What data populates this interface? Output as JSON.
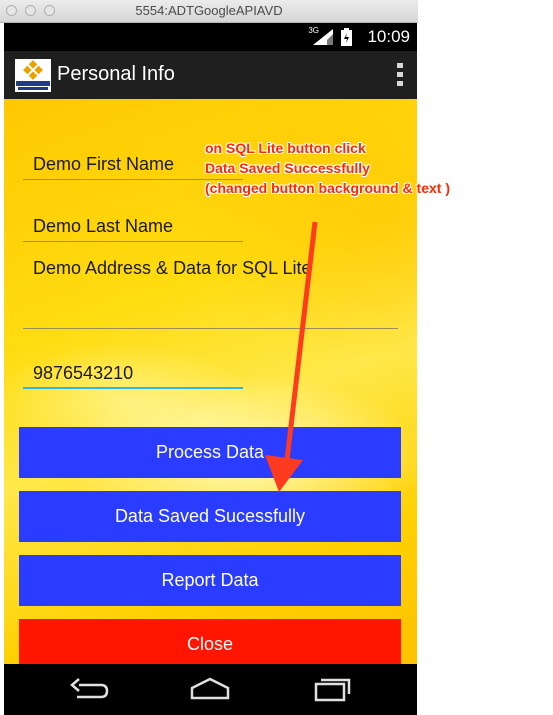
{
  "window": {
    "title": "5554:ADTGoogleAPIAVD"
  },
  "status_bar": {
    "network": "3G",
    "time": "10:09"
  },
  "action_bar": {
    "title": "Personal Info",
    "logo": "sjsu-logo",
    "overflow_icon": "more-vert-icon"
  },
  "form": {
    "first_name": "Demo First Name",
    "last_name": "Demo Last Name",
    "address": "Demo Address & Data for SQL Lite",
    "phone": "9876543210"
  },
  "buttons": {
    "process": "Process Data",
    "sqlite": "Data Saved Sucessfully",
    "report": "Report Data",
    "close": "Close"
  },
  "annotation": {
    "line1": "on SQL Lite button click",
    "line2": "Data Saved Successfully",
    "line3": "(changed button background & text )"
  },
  "nav_bar": {
    "icons": [
      "back-icon",
      "home-icon",
      "recent-apps-icon"
    ]
  },
  "colors": {
    "button_blue": "#2a3cff",
    "button_red": "#ff1500",
    "background_yellow": "#ffd400",
    "annotation_red": "#ff2a00",
    "field_focus": "#33b5e5"
  }
}
